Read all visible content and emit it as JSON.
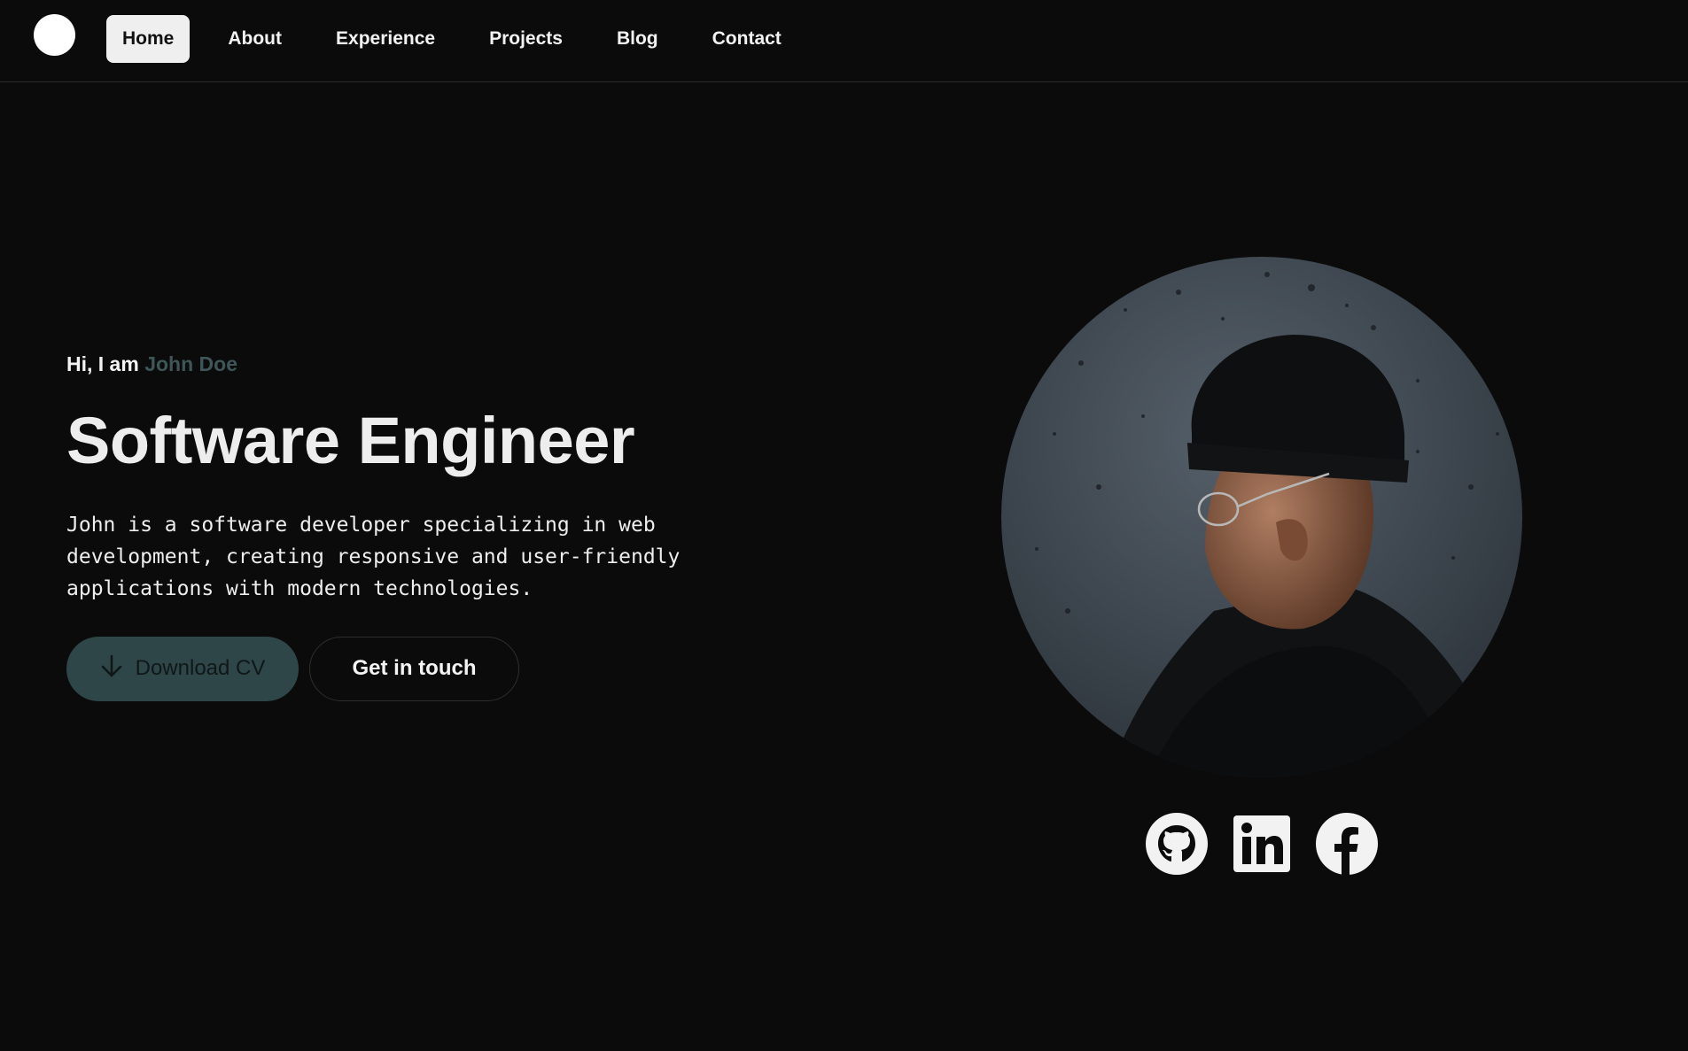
{
  "nav": {
    "items": [
      {
        "label": "Home",
        "active": true
      },
      {
        "label": "About",
        "active": false
      },
      {
        "label": "Experience",
        "active": false
      },
      {
        "label": "Projects",
        "active": false
      },
      {
        "label": "Blog",
        "active": false
      },
      {
        "label": "Contact",
        "active": false
      }
    ]
  },
  "hero": {
    "greeting_prefix": "Hi, I am ",
    "name": "John Doe",
    "title": "Software Engineer",
    "description": "John is a software developer specializing in web development, creating responsive and user-friendly applications with modern technologies.",
    "download_label": "Download CV",
    "contact_label": "Get in touch"
  },
  "socials": [
    {
      "icon": "github-icon"
    },
    {
      "icon": "linkedin-icon"
    },
    {
      "icon": "facebook-icon"
    }
  ],
  "colors": {
    "background": "#0b0b0b",
    "accent": "#2f4649",
    "name_accent": "#3f5659"
  }
}
